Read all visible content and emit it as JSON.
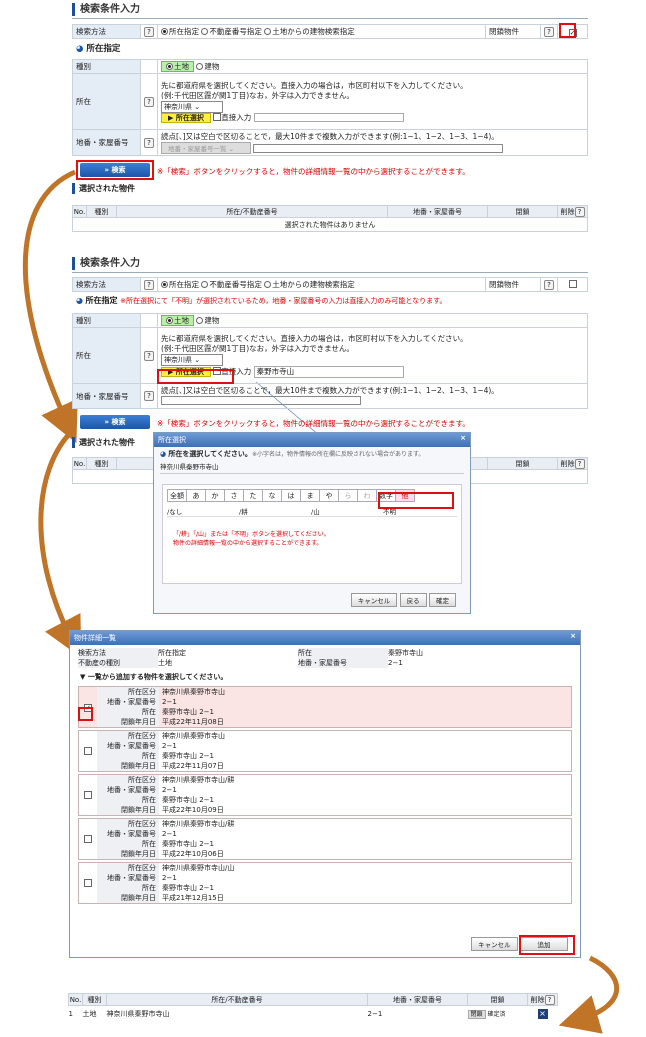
{
  "section1": {
    "title": "検索条件入力",
    "method_label": "検索方法",
    "method_options": [
      "所在指定",
      "不動産番号指定",
      "土地からの建物検索指定"
    ],
    "closed_label": "閉鎖物件",
    "sub_title": "所在指定",
    "type_label": "種別",
    "type_options": [
      "土地",
      "建物"
    ],
    "location_label": "所在",
    "location_note1": "先に都道府県を選択してください。直接入力の場合は，市区町村以下を入力してください。",
    "location_note2": "(例:千代田区霞が関1丁目)なお，外字は入力できません。",
    "prefecture": "神奈川県",
    "location_select_btn": "所在選択",
    "direct_input": "直接入力",
    "lot_label": "地番・家屋番号",
    "lot_note": "読点[、]又は空白で区切ることで，最大10件まで複数入力ができます(例:1−1、1−2、1−3、1−4)。",
    "lot_dropdown": "地番・家屋番号一覧",
    "search_btn": "検索",
    "search_note": "※「検索」ボタンをクリックすると，物件の詳細情報一覧の中から選択することができます。",
    "selected_title": "選択された物件",
    "cols": [
      "No.",
      "種別",
      "所在/不動産番号",
      "地番・家屋番号",
      "閉鎖",
      "削除"
    ],
    "empty": "選択された物件はありません"
  },
  "section2": {
    "title": "検索条件入力",
    "method_label": "検索方法",
    "method_options": [
      "所在指定",
      "不動産番号指定",
      "土地からの建物検索指定"
    ],
    "closed_label": "閉鎖物件",
    "sub_title": "所在指定",
    "warn": "※所在選択にて「不明」が選択されているため，地番・家屋番号の入力は直接入力のみ可能となります。",
    "type_label": "種別",
    "type_options": [
      "土地",
      "建物"
    ],
    "location_label": "所在",
    "location_note1": "先に都道府県を選択してください。直接入力の場合は，市区町村以下を入力してください。",
    "location_note2": "(例:千代田区霞が関1丁目)なお，外字は入力できません。",
    "prefecture": "神奈川県",
    "location_select_btn": "所在選択",
    "direct_input": "直接入力",
    "location_value": "秦野市寺山",
    "lot_label": "地番・家屋番号",
    "lot_note": "読点[、]又は空白で区切ることで，最大10件まで複数入力ができます(例:1−1、1−2、1−3、1−4)。",
    "search_btn": "検索",
    "search_note": "※「検索」ボタンをクリックすると，物件の詳細情報一覧の中から選択することができます。",
    "selected_title": "選択された物件",
    "cols": [
      "No.",
      "種別",
      "閉鎖",
      "削除"
    ]
  },
  "popup1": {
    "title": "所在選択",
    "instr": "所在を選択してください。",
    "instr_small": "※小字名は，物件情報の所在欄に反映されない場合があります。",
    "path": "神奈川県秦野市寺山",
    "tabs": [
      "全額",
      "あ",
      "か",
      "さ",
      "た",
      "な",
      "は",
      "ま",
      "や",
      "ら",
      "わ",
      "数字",
      "他"
    ],
    "items": [
      "/なし",
      "/耕",
      "/山",
      "不明"
    ],
    "note1": "「/耕」「/山」または「不明」ボタンを選択してください。",
    "note2": "物件の詳細情報一覧の中から選択することができます。",
    "cancel": "キャンセル",
    "back": "戻る",
    "ok": "確定"
  },
  "popup2": {
    "title": "物件詳細一覧",
    "info": [
      [
        "検索方法",
        "所在指定",
        "所在",
        "秦野市寺山"
      ],
      [
        "不動産の種別",
        "土地",
        "地番・家屋番号",
        "2−1"
      ]
    ],
    "list_title": "一覧から追加する物件を選択してください。",
    "keys": [
      "所在区分",
      "地番・家屋番号",
      "所在",
      "閉鎖年月日"
    ],
    "cards": [
      {
        "checked": true,
        "v": [
          "神奈川県秦野市寺山",
          "2−1",
          "秦野市寺山 2−1",
          "平成22年11月08日"
        ]
      },
      {
        "checked": false,
        "v": [
          "神奈川県秦野市寺山",
          "2−1",
          "秦野市寺山 2−1",
          "平成22年11月07日"
        ]
      },
      {
        "checked": false,
        "v": [
          "神奈川県秦野市寺山/耕",
          "2−1",
          "秦野市寺山 2−1",
          "平成22年10月09日"
        ]
      },
      {
        "checked": false,
        "v": [
          "神奈川県秦野市寺山/耕",
          "2−1",
          "秦野市寺山 2−1",
          "平成22年10月06日"
        ]
      },
      {
        "checked": false,
        "v": [
          "神奈川県秦野市寺山/山",
          "2−1",
          "秦野市寺山 2−1",
          "平成21年12月15日"
        ]
      }
    ],
    "cancel": "キャンセル",
    "add": "追加"
  },
  "result": {
    "cols": [
      "No.",
      "種別",
      "所在/不動産番号",
      "地番・家屋番号",
      "閉鎖",
      "削除"
    ],
    "row": [
      "1",
      "土地",
      "神奈川県秦野市寺山",
      "2−1",
      "閉鎖",
      "確定済"
    ]
  },
  "colors": {
    "accent": "#1e55a8",
    "highlight": "#d11",
    "arrow": "#c07428"
  }
}
